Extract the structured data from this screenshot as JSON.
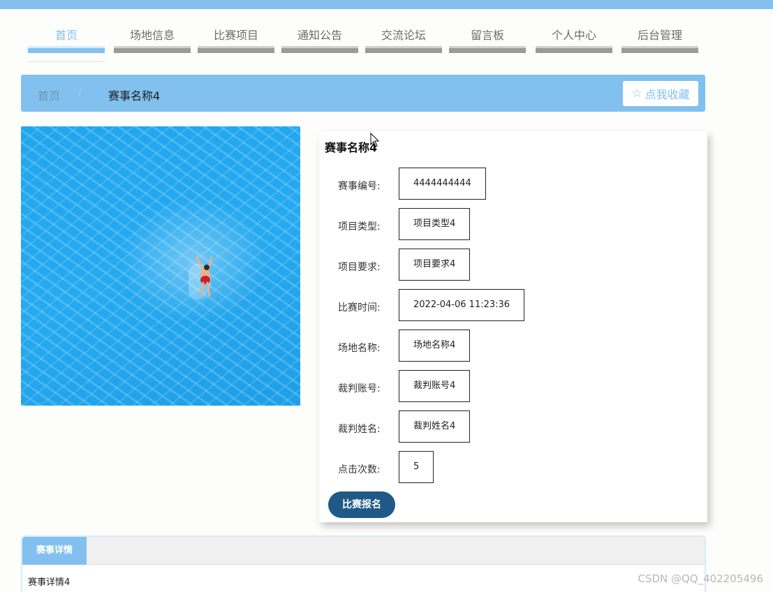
{
  "nav": {
    "items": [
      {
        "label": "首页",
        "active": true
      },
      {
        "label": "场地信息",
        "active": false
      },
      {
        "label": "比赛项目",
        "active": false
      },
      {
        "label": "通知公告",
        "active": false
      },
      {
        "label": "交流论坛",
        "active": false
      },
      {
        "label": "留言板",
        "active": false
      },
      {
        "label": "个人中心",
        "active": false
      },
      {
        "label": "后台管理",
        "active": false
      }
    ]
  },
  "breadcrumb": {
    "home": "首页",
    "separator": "/",
    "current": "赛事名称4"
  },
  "favorite_button": {
    "icon": "star-outline-icon",
    "label": "点我收藏"
  },
  "detail": {
    "title": "赛事名称4",
    "fields": [
      {
        "label": "赛事编号:",
        "value": "4444444444"
      },
      {
        "label": "项目类型:",
        "value": "项目类型4"
      },
      {
        "label": "项目要求:",
        "value": "项目要求4"
      },
      {
        "label": "比赛时间:",
        "value": "2022-04-06 11:23:36"
      },
      {
        "label": "场地名称:",
        "value": "场地名称4"
      },
      {
        "label": "裁判账号:",
        "value": "裁判账号4"
      },
      {
        "label": "裁判姓名:",
        "value": "裁判姓名4"
      },
      {
        "label": "点击次数:",
        "value": "5"
      }
    ],
    "signup_button": "比赛报名"
  },
  "tabs": {
    "active_label": "赛事详情",
    "content": "赛事详情4"
  },
  "watermark": "CSDN @QQ_402205496",
  "colors": {
    "accent": "#82c0ef",
    "button_dark": "#1f5987",
    "nav_bar_gray": "#9a9a9a"
  }
}
